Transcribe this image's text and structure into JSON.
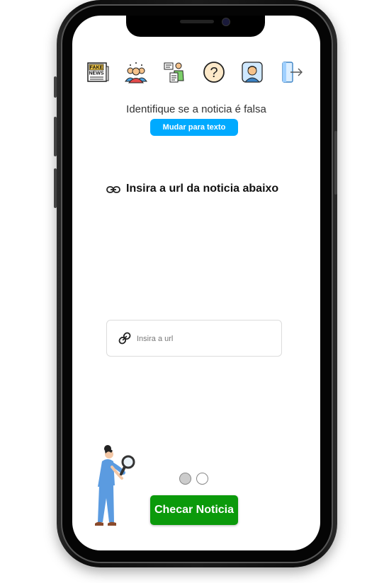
{
  "nav": {
    "icons": [
      "fake-news-icon",
      "group-people-icon",
      "presenter-icon",
      "help-icon",
      "profile-icon",
      "logout-icon"
    ],
    "fake_news_label_top": "FAKE",
    "fake_news_label_bottom": "NEWS",
    "help_glyph": "?"
  },
  "header": {
    "subtitle": "Identifique se a noticia é falsa",
    "mode_button_label": "Mudar para texto"
  },
  "main": {
    "section_title": "Insira a url da noticia abaixo",
    "url_input": {
      "placeholder": "Insira a url",
      "value": ""
    }
  },
  "pager": {
    "active_index": 0,
    "total": 2
  },
  "footer": {
    "check_button_label": "Checar Noticia"
  },
  "colors": {
    "mode_button": "#00aaff",
    "check_button": "#0b9a0b",
    "text": "#333333"
  }
}
